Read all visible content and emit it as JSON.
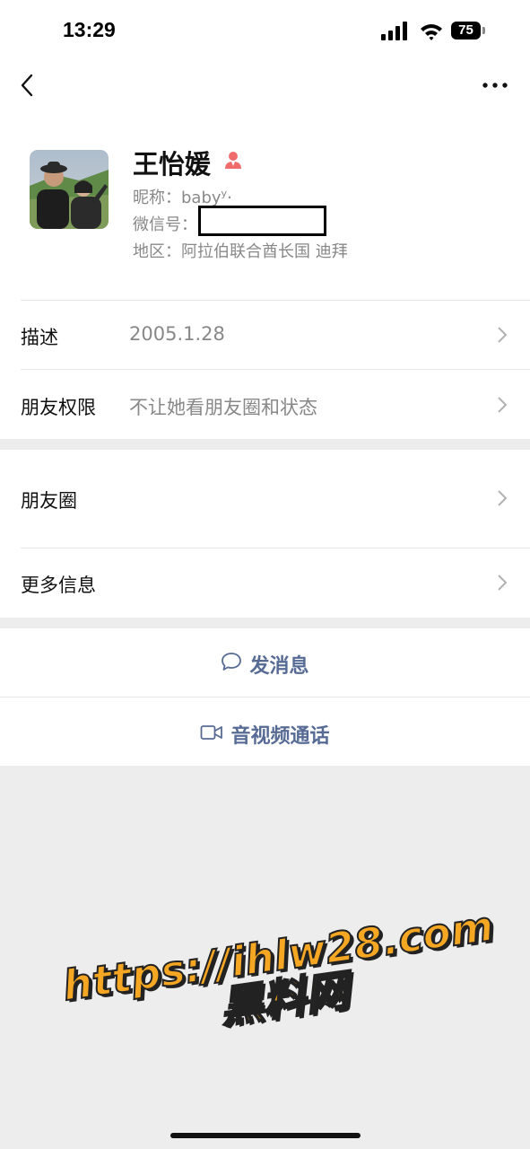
{
  "status_bar": {
    "time": "13:29",
    "battery": "75"
  },
  "profile": {
    "name": "王怡媛",
    "nickname_line": "昵称：baby",
    "nickname_sup": "y",
    "nickname_tail": "·",
    "wechat_id_label": "微信号：",
    "region_line": "地区：阿拉伯联合酋长国 迪拜",
    "gender_icon": "female-icon",
    "gender_color": "#f06b6b"
  },
  "rows": {
    "description_label": "描述",
    "description_value": "2005.1.28",
    "permissions_label": "朋友权限",
    "permissions_value": "不让她看朋友圈和状态",
    "moments_label": "朋友圈",
    "more_info_label": "更多信息"
  },
  "actions": {
    "send_message": "发消息",
    "video_call": "音视频通话",
    "accent_color": "#576b95"
  },
  "watermark": {
    "line1": "https://ihlw28.com",
    "line2": "黑料网"
  }
}
